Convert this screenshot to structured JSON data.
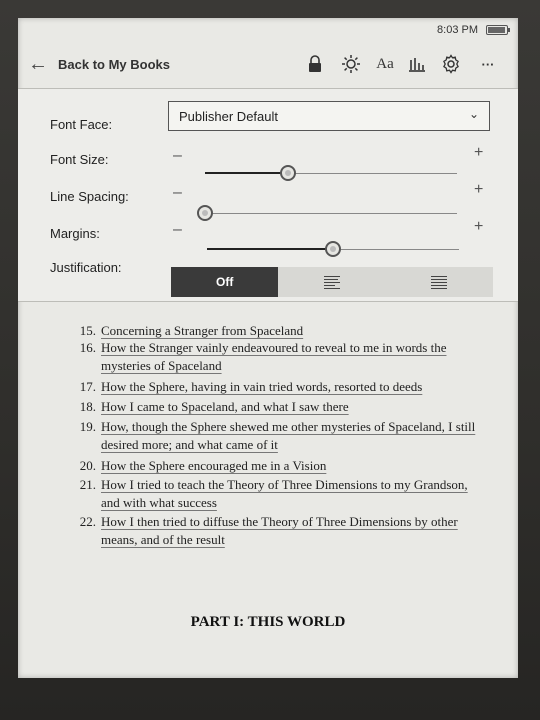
{
  "status": {
    "time": "8:03 PM",
    "battery_level": 0.85
  },
  "toolbar": {
    "back_label": "Back to My Books",
    "icons": [
      "back-arrow-icon",
      "lock-icon",
      "brightness-icon",
      "font-size-icon",
      "stats-icon",
      "gear-icon",
      "more-icon"
    ],
    "font_icon_text": "Aa",
    "more_text": "···"
  },
  "settings": {
    "font_face": {
      "label": "Font Face:",
      "value": "Publisher Default"
    },
    "font_size": {
      "label": "Font Size:",
      "level": 0.33
    },
    "line_spacing": {
      "label": "Line Spacing:",
      "level": 0.0
    },
    "margins": {
      "label": "Margins:",
      "level": 0.5
    },
    "justification": {
      "label": "Justification:",
      "options": [
        "Off",
        "left-align-icon",
        "justify-icon"
      ],
      "selected": "Off"
    }
  },
  "toc": {
    "items": [
      {
        "num": "15.",
        "title": "Concerning a Stranger from Spaceland"
      },
      {
        "num": "16.",
        "title": "How the Stranger vainly endeavoured to reveal to me in words the mysteries of Spaceland"
      },
      {
        "num": "17.",
        "title": "How the Sphere, having in vain tried words, resorted to deeds"
      },
      {
        "num": "18.",
        "title": "How I came to Spaceland, and what I saw there"
      },
      {
        "num": "19.",
        "title": "How, though the Sphere shewed me other mysteries of Spaceland, I still desired more; and what came of it"
      },
      {
        "num": "20.",
        "title": "How the Sphere encouraged me in a Vision"
      },
      {
        "num": "21.",
        "title": "How I tried to teach the Theory of Three Dimensions to my Grandson, and with what success"
      },
      {
        "num": "22.",
        "title": "How I then tried to diffuse the Theory of Three Dimensions by other means, and of the result"
      }
    ],
    "part_title": "PART I: THIS WORLD"
  }
}
